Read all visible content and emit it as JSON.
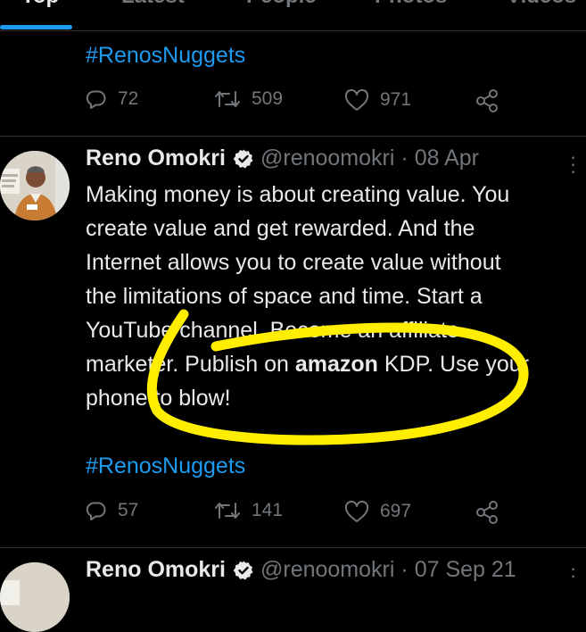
{
  "tabs": [
    {
      "label": "Top",
      "active": true
    },
    {
      "label": "Latest",
      "active": false
    },
    {
      "label": "People",
      "active": false
    },
    {
      "label": "Photos",
      "active": false
    },
    {
      "label": "Videos",
      "active": false
    }
  ],
  "tweet_top": {
    "hashtag": "#RenosNuggets",
    "replies": "72",
    "retweets": "509",
    "likes": "971"
  },
  "tweet_main": {
    "author_name": "Reno Omokri",
    "handle": "@renoomokri",
    "date": "· 08 Apr",
    "lines": [
      "Making money is about creating value. You",
      "create value and get rewarded. And the",
      "Internet allows you to create value without",
      "the limitations of space and time. Start a",
      "YouTube channel. Become an affiliate"
    ],
    "line6_before": "marketer. Publish on ",
    "line6_bold": "amazon",
    "line6_after": " KDP. Use your",
    "line7": "phone to blow!",
    "hashtag": "#RenosNuggets",
    "replies": "57",
    "retweets": "141",
    "likes": "697"
  },
  "tweet_bottom": {
    "author_name": "Reno Omokri",
    "handle": "@renoomokri",
    "date": "· 07 Sep 21"
  },
  "colors": {
    "background": "#000000",
    "text": "#e7e9ea",
    "muted": "#71767b",
    "accent": "#1d9bf0",
    "highlight_marker": "#ffee00"
  },
  "icons": [
    "reply-icon",
    "retweet-icon",
    "like-icon",
    "share-icon",
    "verified-badge-icon",
    "more-options-icon"
  ]
}
